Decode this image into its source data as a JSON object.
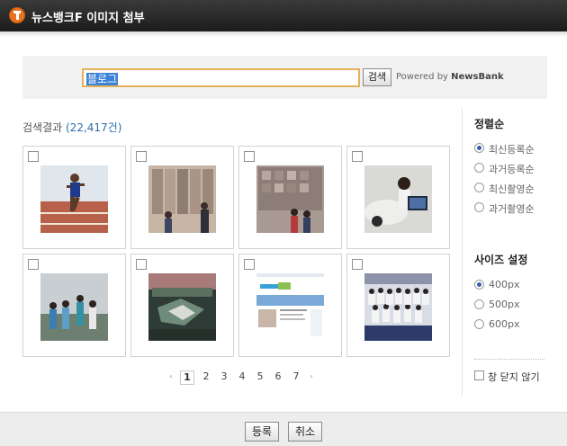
{
  "window": {
    "title": "뉴스뱅크F 이미지 첨부"
  },
  "search": {
    "query": "블로그",
    "button_label": "검색",
    "powered_prefix": "Powered by",
    "powered_brand": "NewsBank"
  },
  "results": {
    "label": "검색결과",
    "count": "(22,417건)",
    "items": [
      {
        "subject": "runner",
        "checked": false
      },
      {
        "subject": "photo-wall-crowd",
        "checked": false
      },
      {
        "subject": "photo-wall-visitors",
        "checked": false
      },
      {
        "subject": "car-tablet-model",
        "checked": false
      },
      {
        "subject": "group-outdoors",
        "checked": false
      },
      {
        "subject": "aerial-model",
        "checked": false
      },
      {
        "subject": "website-screenshot",
        "checked": false
      },
      {
        "subject": "team-group-photo",
        "checked": false
      }
    ]
  },
  "pagination": {
    "prev": "‹",
    "next": "›",
    "pages": [
      "1",
      "2",
      "3",
      "4",
      "5",
      "6",
      "7"
    ],
    "current": "1"
  },
  "sidebar": {
    "sort_heading": "정렬순",
    "sort_options": [
      {
        "label": "최신등록순",
        "selected": true
      },
      {
        "label": "과거등록순",
        "selected": false
      },
      {
        "label": "최신촬영순",
        "selected": false
      },
      {
        "label": "과거촬영순",
        "selected": false
      }
    ],
    "size_heading": "사이즈 설정",
    "size_options": [
      {
        "label": "400px",
        "selected": true
      },
      {
        "label": "500px",
        "selected": false
      },
      {
        "label": "600px",
        "selected": false
      }
    ],
    "keep_open_label": "창 닫지 않기",
    "keep_open_checked": false
  },
  "footer": {
    "submit_label": "등록",
    "cancel_label": "취소"
  },
  "colors": {
    "accent": "#e8731e",
    "selected_radio": "#3a5da8",
    "search_border": "#e4b15a"
  }
}
